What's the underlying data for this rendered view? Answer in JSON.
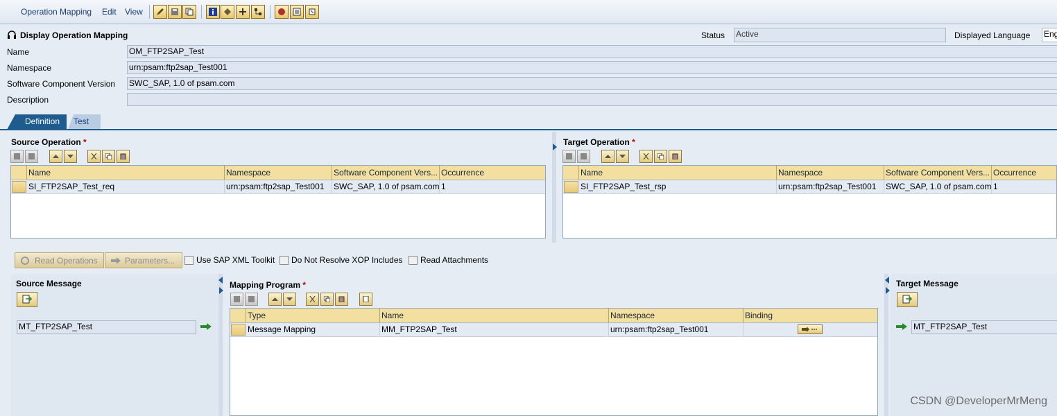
{
  "menu": {
    "items": [
      "Operation Mapping",
      "Edit",
      "View"
    ]
  },
  "toolbar": {
    "icons": [
      "edit-icon",
      "save-icon",
      "copy-icon",
      "info-icon",
      "activate-icon",
      "where-used-icon",
      "compare-icon",
      "delete-icon",
      "display-icon",
      "history-icon"
    ]
  },
  "header": {
    "title": "Display Operation Mapping",
    "status_label": "Status",
    "status_value": "Active",
    "language_label": "Displayed Language",
    "language_value": "Eng",
    "name_label": "Name",
    "name_value": "OM_FTP2SAP_Test",
    "namespace_label": "Namespace",
    "namespace_value": "urn:psam:ftp2sap_Test001",
    "swcv_label": "Software Component Version",
    "swcv_value": "SWC_SAP, 1.0 of psam.com",
    "description_label": "Description",
    "description_value": ""
  },
  "tabs": [
    {
      "label": "Definition",
      "active": true
    },
    {
      "label": "Test",
      "active": false
    }
  ],
  "source_operation": {
    "title": "Source Operation",
    "required": "*",
    "columns": [
      "Name",
      "Namespace",
      "Software Component Vers...",
      "Occurrence"
    ],
    "rows": [
      {
        "name": "SI_FTP2SAP_Test_req",
        "namespace": "urn:psam:ftp2sap_Test001",
        "swcv": "SWC_SAP, 1.0 of psam.com",
        "occurrence": "1"
      }
    ]
  },
  "target_operation": {
    "title": "Target Operation",
    "required": "*",
    "columns": [
      "Name",
      "Namespace",
      "Software Component Vers...",
      "Occurrence"
    ],
    "rows": [
      {
        "name": "SI_FTP2SAP_Test_rsp",
        "namespace": "urn:psam:ftp2sap_Test001",
        "swcv": "SWC_SAP, 1.0 of psam.com",
        "occurrence": "1"
      }
    ]
  },
  "actions": {
    "read_operations": "Read Operations",
    "parameters": "Parameters...",
    "use_xml_toolkit": "Use SAP XML Toolkit",
    "no_resolve_xop": "Do Not Resolve XOP Includes",
    "read_attachments": "Read Attachments"
  },
  "source_message": {
    "title": "Source Message",
    "value": "MT_FTP2SAP_Test"
  },
  "target_message": {
    "title": "Target Message",
    "value": "MT_FTP2SAP_Test"
  },
  "mapping_program": {
    "title": "Mapping Program",
    "required": "*",
    "columns": [
      "Type",
      "Name",
      "Namespace",
      "Binding"
    ],
    "rows": [
      {
        "type": "Message Mapping",
        "name": "MM_FTP2SAP_Test",
        "namespace": "urn:psam:ftp2sap_Test001"
      }
    ]
  },
  "watermark": "CSDN @DeveloperMrMeng",
  "colors": {
    "accent": "#1e5b8f",
    "toolbar_button": "#e8c66a",
    "header_row": "#f3dfa0",
    "required": "#c00000"
  }
}
